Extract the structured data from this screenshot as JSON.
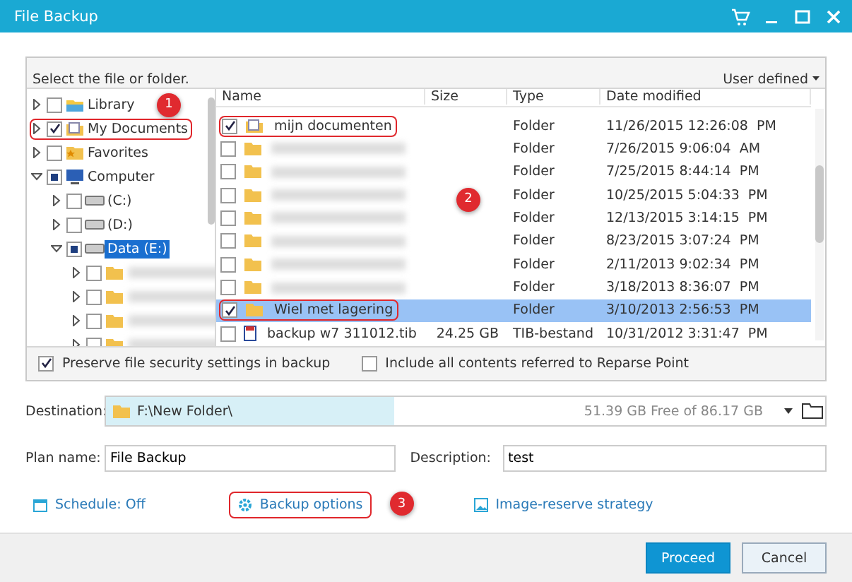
{
  "window": {
    "title": "File Backup"
  },
  "selector": {
    "prompt": "Select the file or folder.",
    "mode": "User defined"
  },
  "tree": [
    {
      "kind": "library",
      "label": "Library",
      "checked": false,
      "expanded": false,
      "selected": false,
      "highlighted": false,
      "badge": "1"
    },
    {
      "kind": "documents",
      "label": "My Documents",
      "checked": true,
      "expanded": false,
      "selected": false,
      "highlighted": true
    },
    {
      "kind": "favorites",
      "label": "Favorites",
      "checked": false,
      "expanded": false,
      "selected": false,
      "highlighted": false
    },
    {
      "kind": "computer",
      "label": "Computer",
      "checked": false,
      "partial": true,
      "expanded": true,
      "selected": false,
      "highlighted": false,
      "children": [
        {
          "kind": "drive",
          "label": "(C:)",
          "checked": false,
          "expanded": false,
          "selected": false,
          "highlighted": false
        },
        {
          "kind": "drive",
          "label": "(D:)",
          "checked": false,
          "expanded": false,
          "selected": false,
          "highlighted": false
        },
        {
          "kind": "drive",
          "label": "Data (E:)",
          "checked": false,
          "partial": true,
          "expanded": true,
          "selected": true,
          "highlighted": false,
          "children": [
            {
              "kind": "blurred-folder",
              "checked": false,
              "expanded": false,
              "highlighted": false
            },
            {
              "kind": "blurred-folder",
              "checked": false,
              "expanded": false,
              "highlighted": false
            },
            {
              "kind": "blurred-folder",
              "checked": false,
              "expanded": false,
              "highlighted": false
            },
            {
              "kind": "blurred-folder",
              "checked": false,
              "expanded": false,
              "highlighted": false
            }
          ]
        }
      ]
    }
  ],
  "file_list": {
    "columns": [
      "Name",
      "Size",
      "Type",
      "Date modified"
    ],
    "badge": "2",
    "rows": [
      {
        "kind": "documents",
        "name": "mijn documenten",
        "type": "Folder",
        "date": "11/26/2015 12:26:08  PM",
        "checked": true,
        "selected": false,
        "highlighted": true
      },
      {
        "kind": "blurred-folder",
        "type": "Folder",
        "date": "7/26/2015 9:06:04  AM",
        "checked": false,
        "selected": false,
        "highlighted": false
      },
      {
        "kind": "blurred-folder",
        "type": "Folder",
        "date": "7/25/2015 8:44:14  PM",
        "checked": false,
        "selected": false,
        "highlighted": false
      },
      {
        "kind": "blurred-folder",
        "type": "Folder",
        "date": "10/25/2015 5:04:33  PM",
        "checked": false,
        "selected": false,
        "highlighted": false
      },
      {
        "kind": "blurred-folder",
        "type": "Folder",
        "date": "12/13/2015 3:14:15  PM",
        "checked": false,
        "selected": false,
        "highlighted": false
      },
      {
        "kind": "blurred-folder",
        "type": "Folder",
        "date": "8/23/2015 3:07:24  PM",
        "checked": false,
        "selected": false,
        "highlighted": false
      },
      {
        "kind": "blurred-folder",
        "type": "Folder",
        "date": "2/11/2013 9:02:34  PM",
        "checked": false,
        "selected": false,
        "highlighted": false
      },
      {
        "kind": "blurred-folder",
        "type": "Folder",
        "date": "3/18/2013 8:36:07  PM",
        "checked": false,
        "selected": false,
        "highlighted": false
      },
      {
        "kind": "folder",
        "name": "Wiel met lagering",
        "type": "Folder",
        "date": "3/10/2013 2:56:53  PM",
        "checked": true,
        "selected": true,
        "highlighted": true
      },
      {
        "kind": "file",
        "name": "backup w7 311012.tib",
        "size": "24.25 GB",
        "type": "TIB-bestand",
        "date": "10/31/2012 3:31:47  PM",
        "checked": false,
        "selected": false,
        "highlighted": false
      }
    ]
  },
  "options": [
    {
      "label": "Preserve file security settings in backup",
      "checked": true
    },
    {
      "label": "Include all contents referred to Reparse Point",
      "checked": false
    }
  ],
  "destination": {
    "label": "Destination:",
    "path": "F:\\New Folder\\",
    "free": "51.39 GB Free of 86.17 GB",
    "level": 0.4
  },
  "plan_name": {
    "label": "Plan name:",
    "value": "File Backup"
  },
  "description": {
    "label": "Description:",
    "value": "test"
  },
  "links": [
    {
      "kind": "schedule",
      "label": "Schedule: Off",
      "highlighted": false
    },
    {
      "kind": "options",
      "label": "Backup options",
      "highlighted": true,
      "badge": "3"
    },
    {
      "kind": "strategy",
      "label": "Image-reserve strategy",
      "highlighted": false
    }
  ],
  "buttons": [
    {
      "label": "Proceed",
      "primary": true
    },
    {
      "label": "Cancel",
      "primary": false
    }
  ]
}
